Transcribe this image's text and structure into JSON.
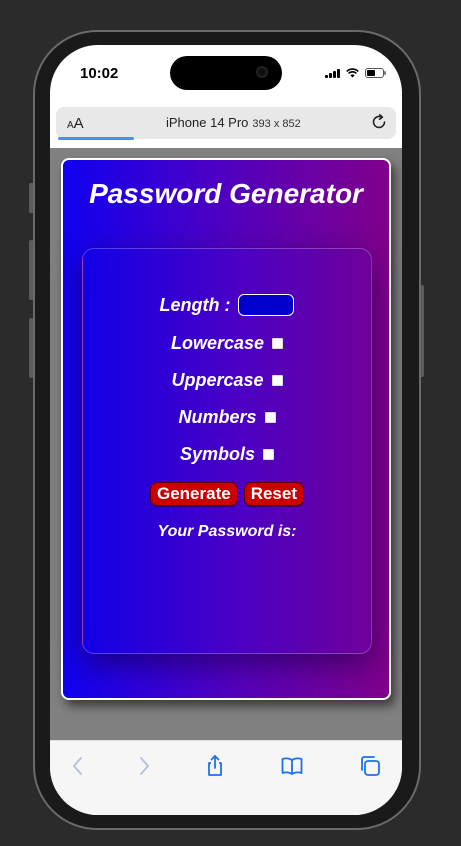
{
  "status": {
    "time": "10:02"
  },
  "browser": {
    "aa_label_small": "A",
    "aa_label_large": "A",
    "device_name": "iPhone 14 Pro",
    "device_size": "393 x 852"
  },
  "page": {
    "title": "Password Generator",
    "length_label": "Length :",
    "length_value": "",
    "options": [
      {
        "label": "Lowercase",
        "checked": false
      },
      {
        "label": "Uppercase",
        "checked": false
      },
      {
        "label": "Numbers",
        "checked": false
      },
      {
        "label": "Symbols",
        "checked": false
      }
    ],
    "generate_label": "Generate",
    "reset_label": "Reset",
    "output_label": "Your Password is:",
    "output_value": ""
  },
  "colors": {
    "gradient_start": "#1000f0",
    "gradient_end": "#80008a",
    "button_bg": "#cc0000",
    "viewport_bg": "#808080"
  },
  "toolbar": {
    "icons": [
      "back-icon",
      "forward-icon",
      "share-icon",
      "bookmarks-icon",
      "tabs-icon"
    ]
  }
}
